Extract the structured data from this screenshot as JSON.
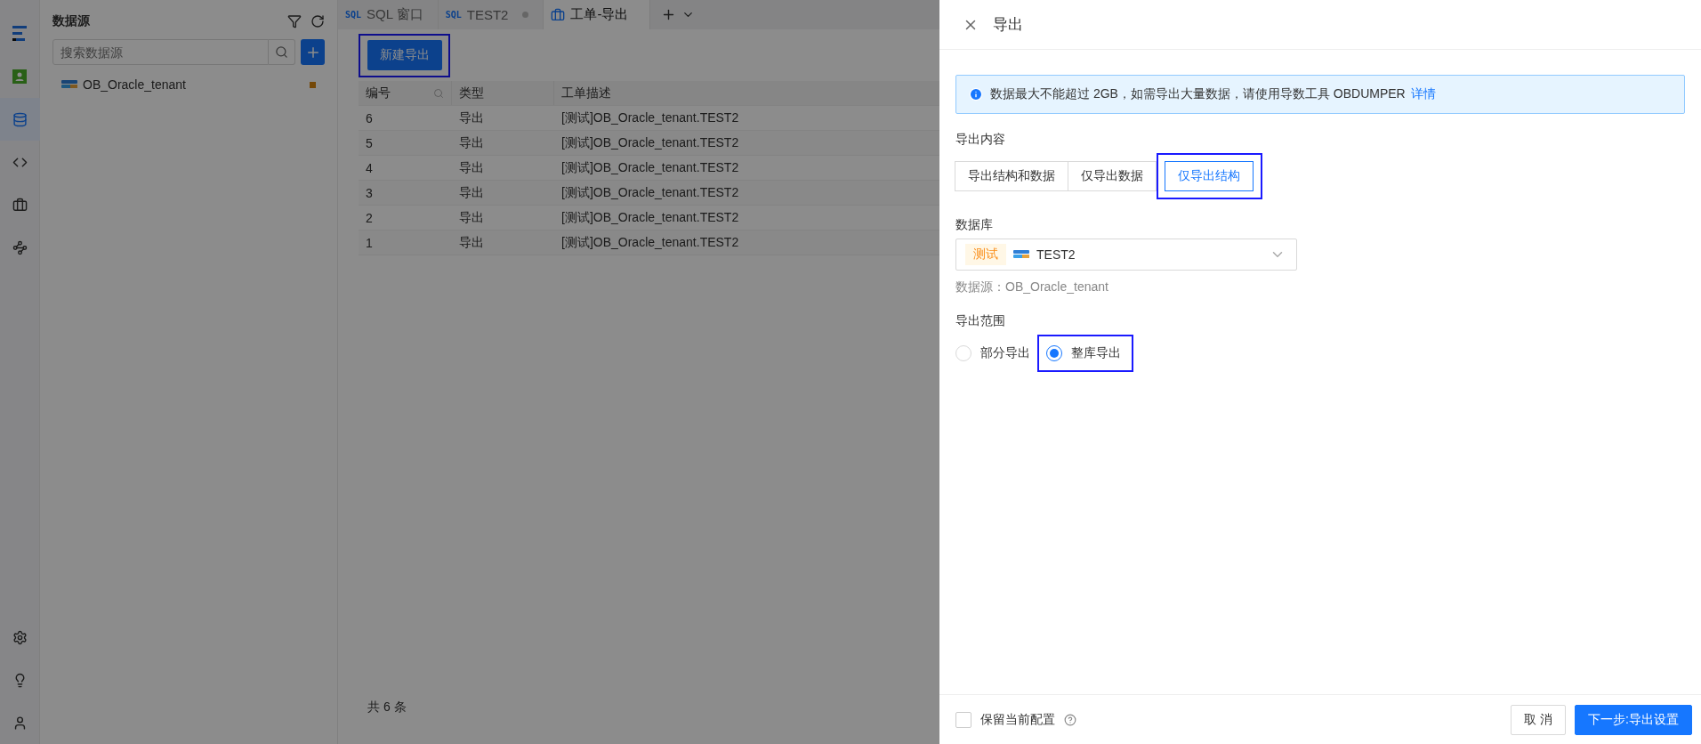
{
  "rail": {
    "items": [
      {
        "kind": "logo",
        "selected": false
      },
      {
        "kind": "avatar",
        "selected": false
      },
      {
        "kind": "database",
        "selected": true
      },
      {
        "kind": "code",
        "selected": false
      },
      {
        "kind": "briefcase",
        "selected": false
      },
      {
        "kind": "network",
        "selected": false
      }
    ],
    "bottom": [
      {
        "kind": "settings"
      },
      {
        "kind": "bulb"
      },
      {
        "kind": "user"
      }
    ]
  },
  "sidebar": {
    "title": "数据源",
    "search": {
      "placeholder": "搜索数据源"
    },
    "tree": [
      {
        "label": "OB_Oracle_tenant"
      }
    ]
  },
  "tabs": [
    {
      "badge": "SQL",
      "label": "SQL 窗口",
      "kind": "sql",
      "selected": false,
      "modified": false
    },
    {
      "badge": "SQL",
      "label": "TEST2",
      "kind": "sql",
      "selected": false,
      "modified": true
    },
    {
      "label": "工单-导出",
      "kind": "ticket",
      "selected": true,
      "modified": false
    }
  ],
  "toolbar": {
    "button": {
      "label": "新建导出",
      "highlighted": true
    }
  },
  "table": {
    "columns": [
      "编号",
      "类型",
      "工单描述"
    ],
    "rows": [
      [
        "6",
        "导出",
        "[测试]OB_Oracle_tenant.TEST2"
      ],
      [
        "5",
        "导出",
        "[测试]OB_Oracle_tenant.TEST2"
      ],
      [
        "4",
        "导出",
        "[测试]OB_Oracle_tenant.TEST2"
      ],
      [
        "3",
        "导出",
        "[测试]OB_Oracle_tenant.TEST2"
      ],
      [
        "2",
        "导出",
        "[测试]OB_Oracle_tenant.TEST2"
      ],
      [
        "1",
        "导出",
        "[测试]OB_Oracle_tenant.TEST2"
      ]
    ]
  },
  "pagination": {
    "total": "共 6 条"
  },
  "drawer": {
    "title": "导出",
    "alert": {
      "text": "数据最大不能超过 2GB，如需导出大量数据，请使用导数工具 OBDUMPER",
      "link": "详情"
    },
    "content_type": {
      "label": "导出内容",
      "options": [
        {
          "label": "导出结构和数据",
          "selected": false,
          "highlighted": false
        },
        {
          "label": "仅导出数据",
          "selected": false,
          "highlighted": false
        },
        {
          "label": "仅导出结构",
          "selected": true,
          "highlighted": true
        }
      ]
    },
    "database": {
      "label": "数据库",
      "tag": "测试",
      "value": "TEST2",
      "source": "数据源：OB_Oracle_tenant"
    },
    "scope": {
      "label": "导出范围",
      "options": [
        {
          "label": "部分导出",
          "selected": false,
          "highlighted": false
        },
        {
          "label": "整库导出",
          "selected": true,
          "highlighted": true
        }
      ]
    },
    "footer": {
      "keep": {
        "label": "保留当前配置",
        "checked": false
      },
      "buttons": [
        {
          "label": "取 消",
          "kind": "default"
        },
        {
          "label": "下一步:导出设置",
          "kind": "primary"
        }
      ]
    }
  }
}
